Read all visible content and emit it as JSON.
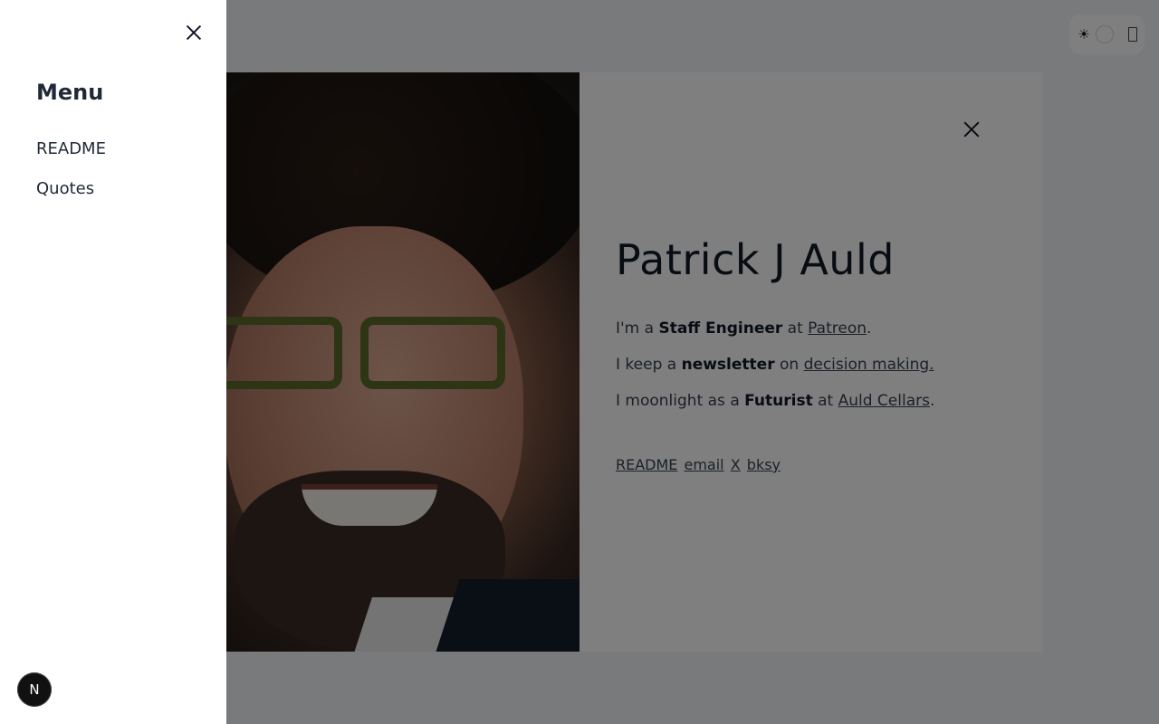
{
  "drawer": {
    "title": "Menu",
    "items": [
      {
        "label": "README"
      },
      {
        "label": "Quotes"
      }
    ],
    "close_icon": "close-icon"
  },
  "theme_toggle": {
    "sun_glyph": "☀",
    "sun_icon": "sun-icon",
    "moon_icon": "moon-icon"
  },
  "profile": {
    "name": "Patrick J Auld",
    "line1": {
      "prefix": "I'm a ",
      "bold": "Staff Engineer",
      "mid": " at ",
      "link": "Patreon",
      "suffix": "."
    },
    "line2": {
      "prefix": "I keep a ",
      "bold": "newsletter",
      "mid": " on ",
      "link": "decision making.",
      "suffix": ""
    },
    "line3": {
      "prefix": "I moonlight as a ",
      "bold": "Futurist",
      "mid": " at ",
      "link": "Auld Cellars",
      "suffix": "."
    },
    "links": [
      {
        "label": "README"
      },
      {
        "label": "email"
      },
      {
        "label": "X"
      },
      {
        "label": "bksy"
      }
    ]
  },
  "next_badge": {
    "letter": "N"
  },
  "colors": {
    "overlay": "rgba(0,0,0,0.5)",
    "text_dark": "#111827",
    "drawer_bg": "#ffffff"
  }
}
